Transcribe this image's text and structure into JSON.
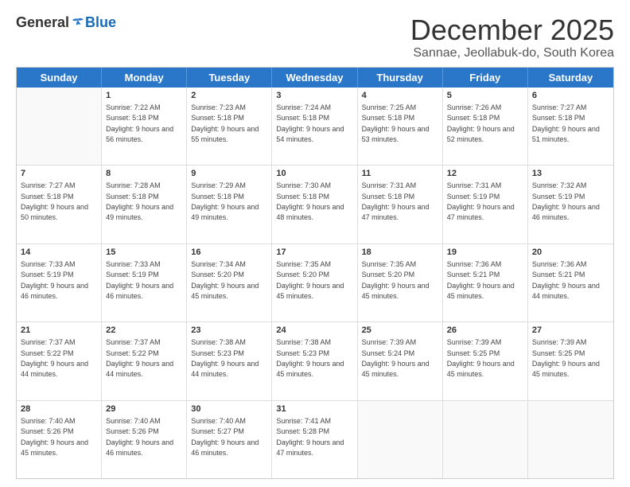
{
  "logo": {
    "general": "General",
    "blue": "Blue"
  },
  "title": "December 2025",
  "subtitle": "Sannae, Jeollabuk-do, South Korea",
  "days": [
    "Sunday",
    "Monday",
    "Tuesday",
    "Wednesday",
    "Thursday",
    "Friday",
    "Saturday"
  ],
  "weeks": [
    [
      {
        "day": "",
        "sunrise": "",
        "sunset": "",
        "daylight": ""
      },
      {
        "day": "1",
        "sunrise": "Sunrise: 7:22 AM",
        "sunset": "Sunset: 5:18 PM",
        "daylight": "Daylight: 9 hours and 56 minutes."
      },
      {
        "day": "2",
        "sunrise": "Sunrise: 7:23 AM",
        "sunset": "Sunset: 5:18 PM",
        "daylight": "Daylight: 9 hours and 55 minutes."
      },
      {
        "day": "3",
        "sunrise": "Sunrise: 7:24 AM",
        "sunset": "Sunset: 5:18 PM",
        "daylight": "Daylight: 9 hours and 54 minutes."
      },
      {
        "day": "4",
        "sunrise": "Sunrise: 7:25 AM",
        "sunset": "Sunset: 5:18 PM",
        "daylight": "Daylight: 9 hours and 53 minutes."
      },
      {
        "day": "5",
        "sunrise": "Sunrise: 7:26 AM",
        "sunset": "Sunset: 5:18 PM",
        "daylight": "Daylight: 9 hours and 52 minutes."
      },
      {
        "day": "6",
        "sunrise": "Sunrise: 7:27 AM",
        "sunset": "Sunset: 5:18 PM",
        "daylight": "Daylight: 9 hours and 51 minutes."
      }
    ],
    [
      {
        "day": "7",
        "sunrise": "Sunrise: 7:27 AM",
        "sunset": "Sunset: 5:18 PM",
        "daylight": "Daylight: 9 hours and 50 minutes."
      },
      {
        "day": "8",
        "sunrise": "Sunrise: 7:28 AM",
        "sunset": "Sunset: 5:18 PM",
        "daylight": "Daylight: 9 hours and 49 minutes."
      },
      {
        "day": "9",
        "sunrise": "Sunrise: 7:29 AM",
        "sunset": "Sunset: 5:18 PM",
        "daylight": "Daylight: 9 hours and 49 minutes."
      },
      {
        "day": "10",
        "sunrise": "Sunrise: 7:30 AM",
        "sunset": "Sunset: 5:18 PM",
        "daylight": "Daylight: 9 hours and 48 minutes."
      },
      {
        "day": "11",
        "sunrise": "Sunrise: 7:31 AM",
        "sunset": "Sunset: 5:18 PM",
        "daylight": "Daylight: 9 hours and 47 minutes."
      },
      {
        "day": "12",
        "sunrise": "Sunrise: 7:31 AM",
        "sunset": "Sunset: 5:19 PM",
        "daylight": "Daylight: 9 hours and 47 minutes."
      },
      {
        "day": "13",
        "sunrise": "Sunrise: 7:32 AM",
        "sunset": "Sunset: 5:19 PM",
        "daylight": "Daylight: 9 hours and 46 minutes."
      }
    ],
    [
      {
        "day": "14",
        "sunrise": "Sunrise: 7:33 AM",
        "sunset": "Sunset: 5:19 PM",
        "daylight": "Daylight: 9 hours and 46 minutes."
      },
      {
        "day": "15",
        "sunrise": "Sunrise: 7:33 AM",
        "sunset": "Sunset: 5:19 PM",
        "daylight": "Daylight: 9 hours and 46 minutes."
      },
      {
        "day": "16",
        "sunrise": "Sunrise: 7:34 AM",
        "sunset": "Sunset: 5:20 PM",
        "daylight": "Daylight: 9 hours and 45 minutes."
      },
      {
        "day": "17",
        "sunrise": "Sunrise: 7:35 AM",
        "sunset": "Sunset: 5:20 PM",
        "daylight": "Daylight: 9 hours and 45 minutes."
      },
      {
        "day": "18",
        "sunrise": "Sunrise: 7:35 AM",
        "sunset": "Sunset: 5:20 PM",
        "daylight": "Daylight: 9 hours and 45 minutes."
      },
      {
        "day": "19",
        "sunrise": "Sunrise: 7:36 AM",
        "sunset": "Sunset: 5:21 PM",
        "daylight": "Daylight: 9 hours and 45 minutes."
      },
      {
        "day": "20",
        "sunrise": "Sunrise: 7:36 AM",
        "sunset": "Sunset: 5:21 PM",
        "daylight": "Daylight: 9 hours and 44 minutes."
      }
    ],
    [
      {
        "day": "21",
        "sunrise": "Sunrise: 7:37 AM",
        "sunset": "Sunset: 5:22 PM",
        "daylight": "Daylight: 9 hours and 44 minutes."
      },
      {
        "day": "22",
        "sunrise": "Sunrise: 7:37 AM",
        "sunset": "Sunset: 5:22 PM",
        "daylight": "Daylight: 9 hours and 44 minutes."
      },
      {
        "day": "23",
        "sunrise": "Sunrise: 7:38 AM",
        "sunset": "Sunset: 5:23 PM",
        "daylight": "Daylight: 9 hours and 44 minutes."
      },
      {
        "day": "24",
        "sunrise": "Sunrise: 7:38 AM",
        "sunset": "Sunset: 5:23 PM",
        "daylight": "Daylight: 9 hours and 45 minutes."
      },
      {
        "day": "25",
        "sunrise": "Sunrise: 7:39 AM",
        "sunset": "Sunset: 5:24 PM",
        "daylight": "Daylight: 9 hours and 45 minutes."
      },
      {
        "day": "26",
        "sunrise": "Sunrise: 7:39 AM",
        "sunset": "Sunset: 5:25 PM",
        "daylight": "Daylight: 9 hours and 45 minutes."
      },
      {
        "day": "27",
        "sunrise": "Sunrise: 7:39 AM",
        "sunset": "Sunset: 5:25 PM",
        "daylight": "Daylight: 9 hours and 45 minutes."
      }
    ],
    [
      {
        "day": "28",
        "sunrise": "Sunrise: 7:40 AM",
        "sunset": "Sunset: 5:26 PM",
        "daylight": "Daylight: 9 hours and 45 minutes."
      },
      {
        "day": "29",
        "sunrise": "Sunrise: 7:40 AM",
        "sunset": "Sunset: 5:26 PM",
        "daylight": "Daylight: 9 hours and 46 minutes."
      },
      {
        "day": "30",
        "sunrise": "Sunrise: 7:40 AM",
        "sunset": "Sunset: 5:27 PM",
        "daylight": "Daylight: 9 hours and 46 minutes."
      },
      {
        "day": "31",
        "sunrise": "Sunrise: 7:41 AM",
        "sunset": "Sunset: 5:28 PM",
        "daylight": "Daylight: 9 hours and 47 minutes."
      },
      {
        "day": "",
        "sunrise": "",
        "sunset": "",
        "daylight": ""
      },
      {
        "day": "",
        "sunrise": "",
        "sunset": "",
        "daylight": ""
      },
      {
        "day": "",
        "sunrise": "",
        "sunset": "",
        "daylight": ""
      }
    ]
  ]
}
